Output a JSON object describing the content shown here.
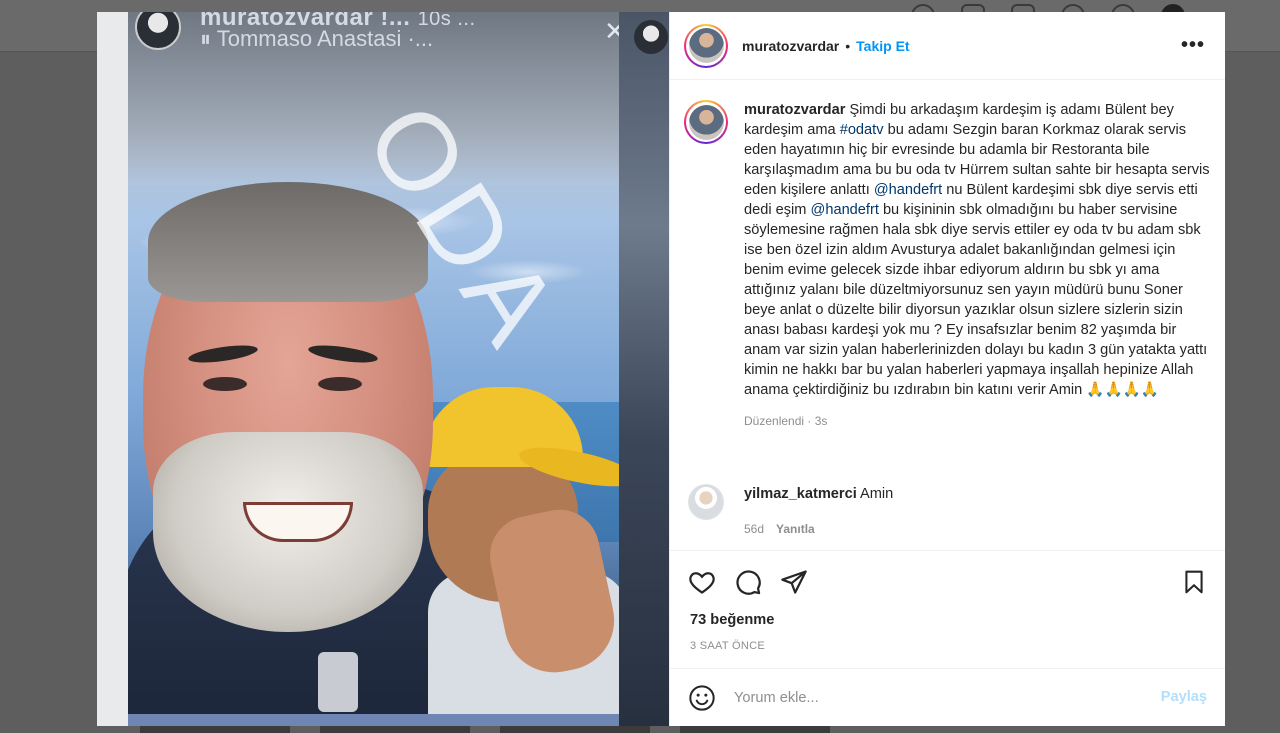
{
  "background_story": {
    "username": "muratozvardar !...",
    "username_suffix": "10s ...",
    "music": "Tommaso Anastasi ·...",
    "watermark": "ODA"
  },
  "post": {
    "username": "muratozvardar",
    "separator": "•",
    "follow_label": "Takip Et",
    "more_label": "•••"
  },
  "caption": {
    "username": "muratozvardar",
    "parts": {
      "t1": " Şimdi bu arkadaşım kardeşim iş adamı Bülent bey kardeşim ama ",
      "m1": "#odatv",
      "t2": " bu adamı Sezgin baran Korkmaz olarak servis eden hayatımın hiç bir evresinde bu adamla bir Restoranta bile karşılaşmadım ama bu bu oda tv Hürrem sultan sahte bir hesapta servis eden kişilere anlattı ",
      "m2": "@handefrt",
      "t3": " nu Bülent kardeşimi sbk diye servis etti dedi eşim ",
      "m3": "@handefrt",
      "t4": " bu kişininin sbk olmadığını bu haber servisine söylemesine rağmen hala sbk diye servis ettiler ey oda tv bu adam sbk ise ben özel izin aldım Avusturya adalet bakanlığından gelmesi için benim evime gelecek sizde ihbar ediyorum aldırın bu sbk yı ama attığınız yalanı bile düzeltmiyorsunuz sen yayın müdürü bunu Soner beye anlat o düzelte bilir diyorsun yazıklar olsun sizlere sizlerin sizin anası babası kardeşi yok mu ? Ey insafsızlar benim 82 yaşımda bir anam var sizin yalan haberlerinizden dolayı bu kadın 3 gün yatakta yattı kimin ne hakkı bar bu yalan haberleri yapmaya inşallah hepinize Allah anama çektirdiğiniz bu ızdırabın bin katını verir Amin 🙏🙏🙏🙏"
    },
    "meta": "Düzenlendi · 3s"
  },
  "comment": {
    "username": "yilmaz_katmerci",
    "text": "Amin",
    "age": "56d",
    "reply_label": "Yanıtla"
  },
  "stats": {
    "likes": "73 beğenme",
    "time": "3 SAAT ÖNCE"
  },
  "composer": {
    "placeholder": "Yorum ekle...",
    "share_label": "Paylaş"
  }
}
